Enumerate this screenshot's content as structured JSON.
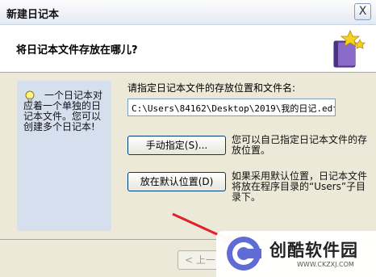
{
  "window": {
    "title": "新建日记本",
    "close_glyph": "X"
  },
  "header": {
    "question": "将日记本文件存放在哪儿?",
    "icon": "diary-book-with-stars-icon"
  },
  "hint": {
    "icon": "lightbulb-icon",
    "text": "一个日记本对应着一个单独的日记本文件。您可以创建多个日记本!"
  },
  "main": {
    "path_label": "请指定日记本文件的存放位置和文件名:",
    "path_value": "C:\\Users\\84162\\Desktop\\2019\\我的日记.edf"
  },
  "buttons": {
    "manual": "手动指定(S)...",
    "manual_desc": "您可以自己指定日记本文件的存放位置。",
    "default": "放在默认位置(D)",
    "default_desc": "如果采用默认位置，日记本文件将放在程序目录的“Users”子目录下。",
    "back": "< 上一"
  },
  "colors": {
    "annotation_arrow": "#e0202a",
    "hint_panel": "#d6dfee",
    "watermark_accent": "#5f6cd6"
  },
  "watermark": {
    "title": "创酷软件园",
    "url": "WWW.CKZXJ.COM"
  }
}
